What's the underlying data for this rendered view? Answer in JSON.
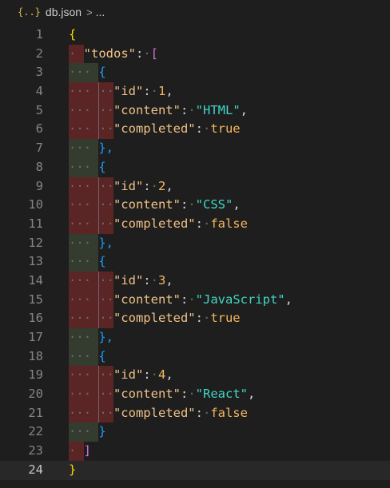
{
  "breadcrumb": {
    "icon": "{..}",
    "file": "db.json",
    "separator": ">",
    "more": "..."
  },
  "line_numbers": [
    "1",
    "2",
    "3",
    "4",
    "5",
    "6",
    "7",
    "8",
    "9",
    "10",
    "11",
    "12",
    "13",
    "14",
    "15",
    "16",
    "17",
    "18",
    "19",
    "20",
    "21",
    "22",
    "23",
    "24"
  ],
  "current_line": 24,
  "todos_key": "\"todos\"",
  "id_key": "\"id\"",
  "content_key": "\"content\"",
  "completed_key": "\"completed\"",
  "todos": [
    {
      "id": "1",
      "content": "\"HTML\"",
      "completed": "true"
    },
    {
      "id": "2",
      "content": "\"CSS\"",
      "completed": "false"
    },
    {
      "id": "3",
      "content": "\"JavaScript\"",
      "completed": "true"
    },
    {
      "id": "4",
      "content": "\"React\"",
      "completed": "false"
    }
  ],
  "punct": {
    "open_brace": "{",
    "close_brace": "}",
    "open_bracket": "[",
    "close_bracket": "]",
    "colon": ":",
    "comma": ",",
    "close_brace_comma": "},",
    "space_dot": "·"
  },
  "colors": {
    "background": "#1e1e1e",
    "key": "#f1c388",
    "string": "#3fd6c4",
    "number": "#f4b65f",
    "bracket_level1": "#ffd700",
    "bracket_level2": "#da70d6",
    "bracket_level3": "#179fff",
    "indent_error": "#5b2425",
    "indent_ok": "#343c30"
  }
}
